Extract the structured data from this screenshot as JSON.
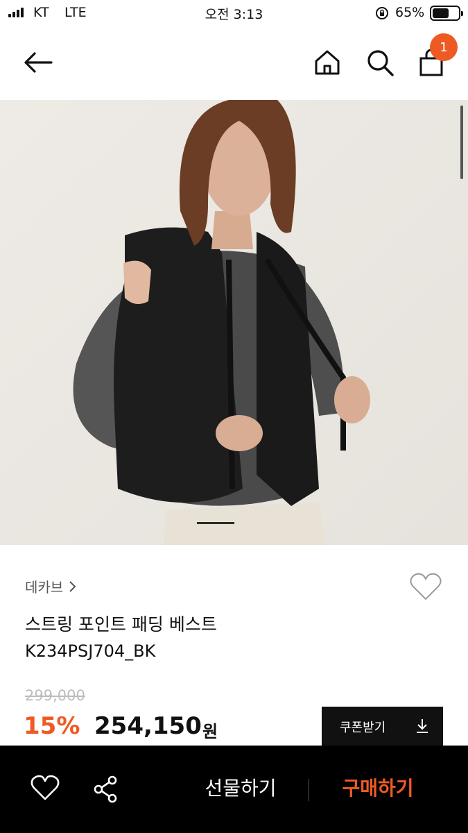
{
  "status_bar": {
    "carrier": "KT",
    "network": "LTE",
    "time": "오전 3:13",
    "battery_percent": "65%",
    "battery_level": 0.65
  },
  "nav": {
    "cart_count": "1",
    "accent_color": "#ee5a24"
  },
  "product": {
    "brand": "데카브",
    "name": "스트링 포인트 패딩 베스트",
    "code": "K234PSJ704_BK",
    "original_price": "299,000",
    "discount": "15%",
    "sale_price": "254,150",
    "currency": "원"
  },
  "coupon": {
    "label": "쿠폰받기"
  },
  "bottom_bar": {
    "gift_label": "선물하기",
    "buy_label": "구매하기"
  }
}
